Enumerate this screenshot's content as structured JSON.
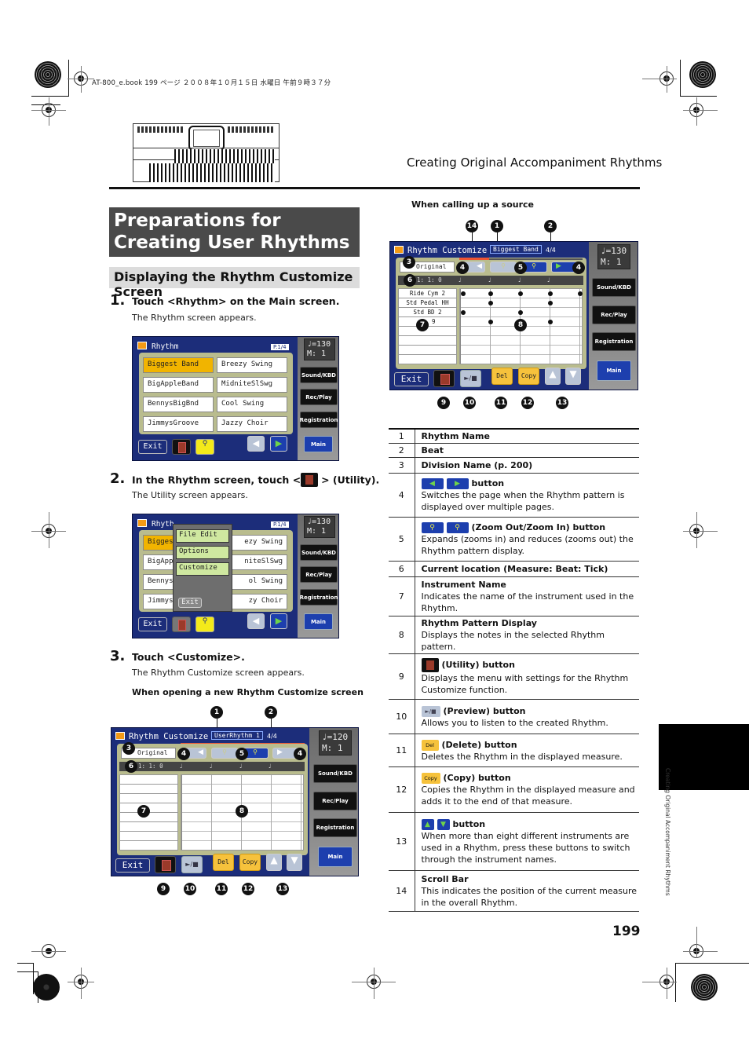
{
  "print_header": "AT-800_e.book  199 ページ  ２００８年１０月１５日  水曜日  午前９時３７分",
  "running_header": "Creating Original Accompaniment Rhythms",
  "main_title": "Preparations for Creating User Rhythms",
  "sub_title": "Displaying the Rhythm Customize Screen",
  "steps": [
    {
      "num": "1.",
      "text": "Touch <Rhythm> on the Main screen.",
      "desc": "The Rhythm screen appears."
    },
    {
      "num": "2.",
      "text_before": "In the Rhythm screen, touch <",
      "text_after": "> (Utility).",
      "desc": "The Utility screen appears."
    },
    {
      "num": "3.",
      "text": "Touch <Customize>.",
      "desc": "The Rhythm Customize screen appears."
    }
  ],
  "caption_new": "When opening a new Rhythm Customize screen",
  "caption_source": "When calling up a source",
  "rhythm_screen": {
    "title": "Rhythm",
    "page": "P.1/4",
    "tempo": "♩=130",
    "measure": "M:   1",
    "rhythms": [
      "Biggest Band",
      "Breezy Swing",
      "BigAppleBand",
      "MidniteSlSwg",
      "BennysBigBnd",
      "Cool Swing",
      "JimmysGroove",
      "Jazzy Choir"
    ],
    "selected": "Biggest Band",
    "exit": "Exit",
    "side_buttons": [
      "Sound/KBD",
      "Rec/Play",
      "Registration"
    ],
    "main": "Main"
  },
  "utility_screen": {
    "title": "Rhyth",
    "visible_rhythms": [
      "Biggest",
      "ezy Swing",
      "BigAppl",
      "niteSlSwg",
      "Bennys",
      "ol Swing",
      "Jimmys",
      "zy Choir"
    ],
    "menu_items": [
      "File Edit",
      "Options",
      "Customize"
    ],
    "menu_exit": "Exit"
  },
  "customize_new": {
    "title": "Rhythm Customize",
    "rhythm_name": "UserRhythm 1",
    "beat": "4/4",
    "tempo": "♩=120",
    "measure": "M:   1",
    "division": "Original",
    "location": "1: 1:  0",
    "instruments": [],
    "buttons": {
      "exit": "Exit",
      "del": "Del",
      "copy": "Copy",
      "preview": "►/■"
    },
    "callouts": [
      "1",
      "2",
      "3",
      "4",
      "5",
      "4",
      "6",
      "7",
      "8",
      "9",
      "10",
      "11",
      "12",
      "13"
    ]
  },
  "customize_source": {
    "title": "Rhythm Customize",
    "rhythm_name": "Biggest Band",
    "beat": "4/4",
    "tempo": "♩=130",
    "measure": "M:   1",
    "division": "Original",
    "location": "1: 1:  0",
    "instruments": [
      "Ride Cym 2",
      "Std Pedal HH",
      "Std BD 2",
      "9"
    ],
    "pattern": [
      [
        0,
        1,
        2,
        3,
        4
      ],
      [
        1,
        3
      ],
      [
        0,
        2
      ],
      [
        1,
        2,
        3
      ]
    ],
    "buttons": {
      "exit": "Exit",
      "del": "Del",
      "copy": "Copy",
      "preview": "►/■"
    },
    "callouts": [
      "14",
      "1",
      "2",
      "3",
      "4",
      "5",
      "4",
      "6",
      "7",
      "8",
      "9",
      "10",
      "11",
      "12",
      "13"
    ]
  },
  "legend": [
    {
      "num": "1",
      "title": "Rhythm Name",
      "desc": ""
    },
    {
      "num": "2",
      "title": "Beat",
      "desc": ""
    },
    {
      "num": "3",
      "title": "Division Name (p. 200)",
      "desc": ""
    },
    {
      "num": "4",
      "title": "button",
      "icon": "left-right-buttons",
      "desc": "Switches the page when the Rhythm pattern is displayed over multiple pages."
    },
    {
      "num": "5",
      "title": "(Zoom Out/Zoom In) button",
      "icon": "zoom-buttons",
      "desc": "Expands (zooms in) and reduces (zooms out) the Rhythm pattern display."
    },
    {
      "num": "6",
      "title": "Current location (Measure: Beat: Tick)",
      "desc": ""
    },
    {
      "num": "7",
      "title": "Instrument Name",
      "desc": "Indicates the name of the instrument used in the Rhythm."
    },
    {
      "num": "8",
      "title": "Rhythm Pattern Display",
      "desc": "Displays the notes in the selected Rhythm pattern."
    },
    {
      "num": "9",
      "title": "(Utility) button",
      "icon": "utility-button",
      "desc": "Displays the menu with settings for the Rhythm Customize function."
    },
    {
      "num": "10",
      "title": "(Preview) button",
      "icon": "preview-button",
      "icon_label": "►/■",
      "desc": "Allows you to listen to the created Rhythm."
    },
    {
      "num": "11",
      "title": "(Delete) button",
      "icon": "delete-button",
      "icon_label": "Del",
      "desc": "Deletes the Rhythm in the displayed measure."
    },
    {
      "num": "12",
      "title": "(Copy) button",
      "icon": "copy-button",
      "icon_label": "Copy",
      "desc": "Copies the Rhythm in the displayed measure and adds it to the end of that measure."
    },
    {
      "num": "13",
      "title": "button",
      "icon": "up-down-buttons",
      "desc": "When more than eight different instruments are used in a Rhythm, press these buttons to switch through the instrument names."
    },
    {
      "num": "14",
      "title": "Scroll Bar",
      "desc": "This indicates the position of the current measure in the overall Rhythm."
    }
  ],
  "side_tab_text": "Creating Original Accompaniment Rhythms",
  "page_number": "199",
  "colors": {
    "screen_blue": "#1c2d7a",
    "select_orange": "#f1b400",
    "title_gray": "#4a4a4a",
    "menu_green": "#cfe8a0"
  }
}
